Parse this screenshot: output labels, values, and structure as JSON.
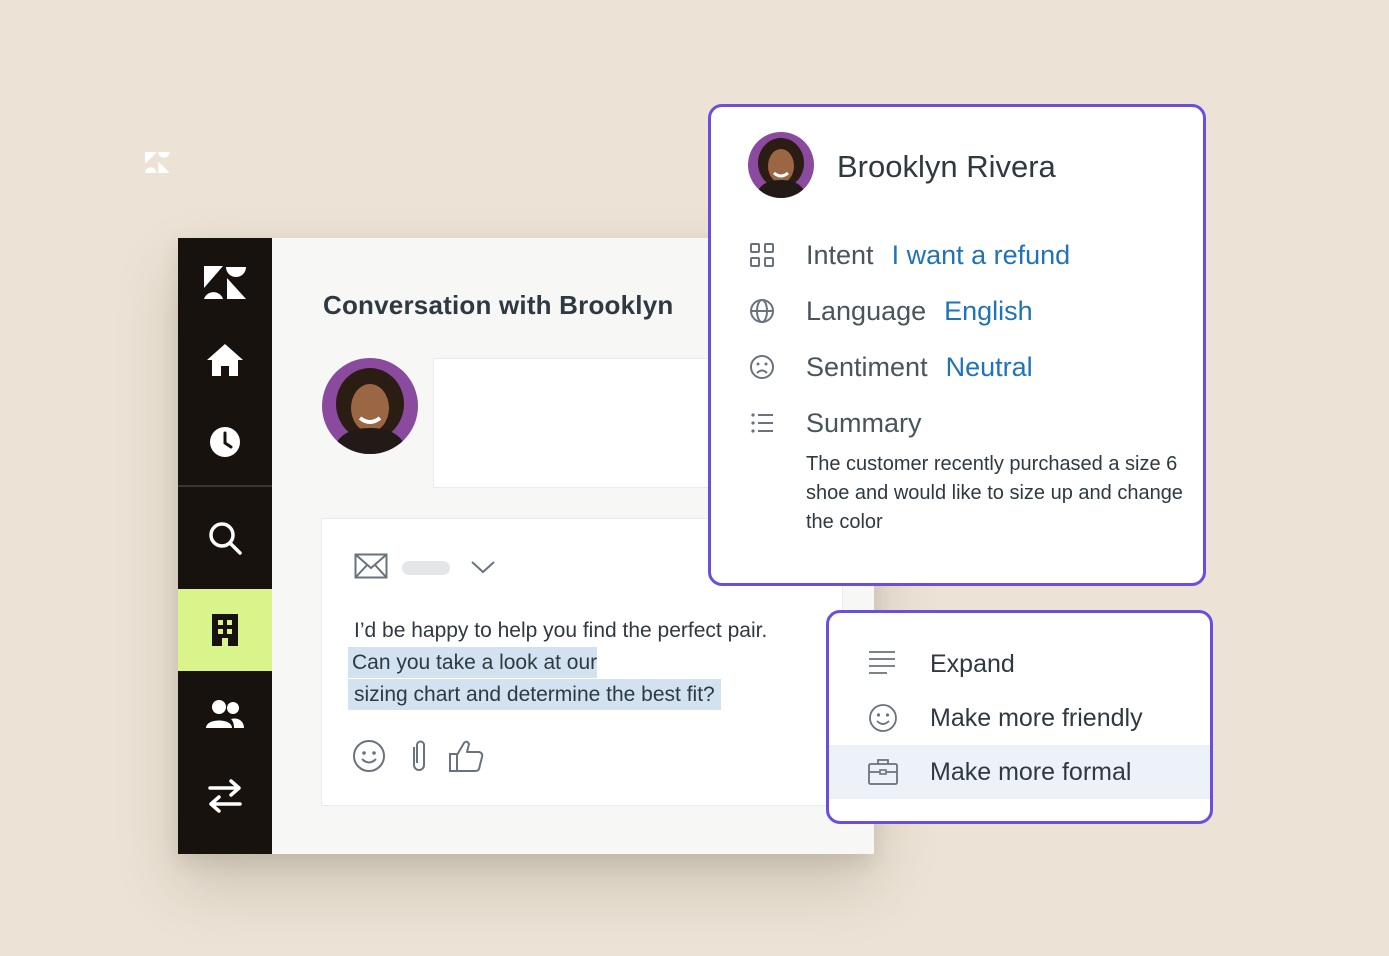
{
  "brand": {
    "logo_icon": "zendesk-logo-icon"
  },
  "sidebar": {
    "items": [
      {
        "icon": "zendesk-logo-icon"
      },
      {
        "icon": "home-icon"
      },
      {
        "icon": "clock-icon"
      },
      {
        "icon": "search-icon"
      },
      {
        "icon": "building-icon",
        "active": true
      },
      {
        "icon": "users-icon"
      },
      {
        "icon": "transfer-arrows-icon"
      }
    ],
    "active_color": "#d8f48a",
    "bg_color": "#17120d"
  },
  "conversation": {
    "title": "Conversation with Brooklyn",
    "reply": {
      "text_plain": "I’d be happy to help you find the perfect pair.",
      "text_selected_line1": "Can you take a look at our",
      "text_selected_line2": "sizing chart and determine the best fit?"
    },
    "composer_icons": [
      "mail-icon",
      "chevron-down-icon",
      "smiley-icon",
      "paperclip-icon",
      "thumbs-up-icon"
    ]
  },
  "customer_card": {
    "name": "Brooklyn Rivera",
    "fields": [
      {
        "icon": "grid-icon",
        "label": "Intent",
        "value": "I want a refund"
      },
      {
        "icon": "globe-icon",
        "label": "Language",
        "value": "English"
      },
      {
        "icon": "frown-icon",
        "label": "Sentiment",
        "value": "Neutral"
      },
      {
        "icon": "list-icon",
        "label": "Summary"
      }
    ],
    "summary_text": "The customer recently purchased a size 6 shoe and would like to size up and change the color",
    "border_color": "#6a4ee0",
    "value_color": "#1f73b7"
  },
  "ai_menu": {
    "items": [
      {
        "icon": "lines-icon",
        "label": "Expand"
      },
      {
        "icon": "smiley-icon",
        "label": "Make more friendly"
      },
      {
        "icon": "briefcase-icon",
        "label": "Make more formal",
        "selected": true
      }
    ]
  }
}
